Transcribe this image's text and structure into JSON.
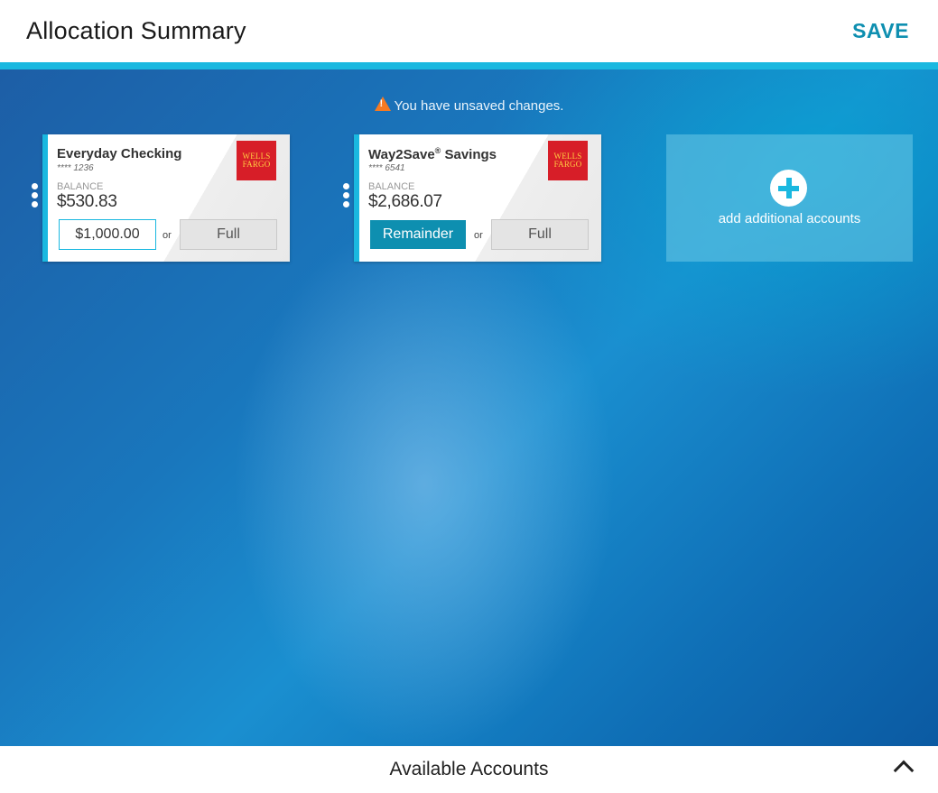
{
  "header": {
    "title": "Allocation Summary",
    "save_label": "SAVE"
  },
  "warning": {
    "icon": "warning-icon",
    "text": "You have unsaved changes."
  },
  "accounts": [
    {
      "name": "Everyday Checking",
      "number": "**** 1236",
      "balance_label": "BALANCE",
      "balance": "$530.83",
      "bank_logo": "WELLS FARGO",
      "allocation_value": "$1,000.00",
      "or_label": "or",
      "full_label": "Full"
    },
    {
      "name": "Way2Save",
      "name_mark": "®",
      "name_suffix": " Savings",
      "number": "**** 6541",
      "balance_label": "BALANCE",
      "balance": "$2,686.07",
      "bank_logo": "WELLS FARGO",
      "remainder_label": "Remainder",
      "or_label": "or",
      "full_label": "Full"
    }
  ],
  "add_tile": {
    "icon": "plus-circle-icon",
    "label": "add additional accounts"
  },
  "footer": {
    "label": "Available Accounts",
    "icon": "chevron-up-icon"
  },
  "colors": {
    "accent": "#1ab8e0",
    "brand": "#0e8fb0",
    "warning": "#f57a22",
    "logo_bg": "#d71e28",
    "logo_text": "#ffcd41"
  }
}
